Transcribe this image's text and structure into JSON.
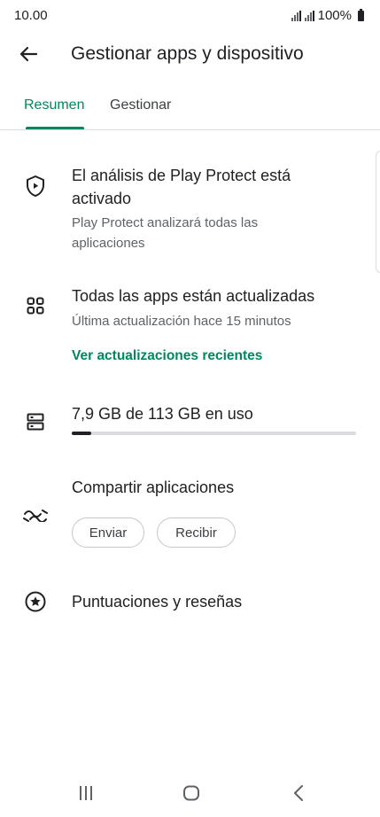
{
  "status_bar": {
    "time": "10.00",
    "battery": "100%"
  },
  "header": {
    "title": "Gestionar apps y dispositivo",
    "back_icon": "arrow-left-icon"
  },
  "tabs": [
    {
      "label": "Resumen",
      "active": true
    },
    {
      "label": "Gestionar",
      "active": false
    }
  ],
  "play_protect": {
    "icon": "shield-play-icon",
    "title": "El análisis de Play Protect está activado",
    "subtitle": "Play Protect analizará todas las aplicaciones"
  },
  "updates": {
    "icon": "apps-grid-icon",
    "title": "Todas las apps están actualizadas",
    "subtitle": "Última actualización hace 15 minutos",
    "link": "Ver actualizaciones recientes"
  },
  "storage": {
    "icon": "storage-icon",
    "title": "7,9 GB de 113 GB en uso",
    "used_fraction": 0.07
  },
  "share": {
    "icon": "share-apps-icon",
    "title": "Compartir aplicaciones",
    "send_label": "Enviar",
    "receive_label": "Recibir"
  },
  "ratings": {
    "icon": "star-circle-icon",
    "title": "Puntuaciones y reseñas"
  },
  "nav_bar": {
    "recents_icon": "recents-icon",
    "home_icon": "home-icon",
    "back_icon": "back-chevron-icon"
  },
  "colors": {
    "accent": "#01875f",
    "text": "#202124",
    "secondary": "#5f6368",
    "divider": "#dadce0"
  }
}
